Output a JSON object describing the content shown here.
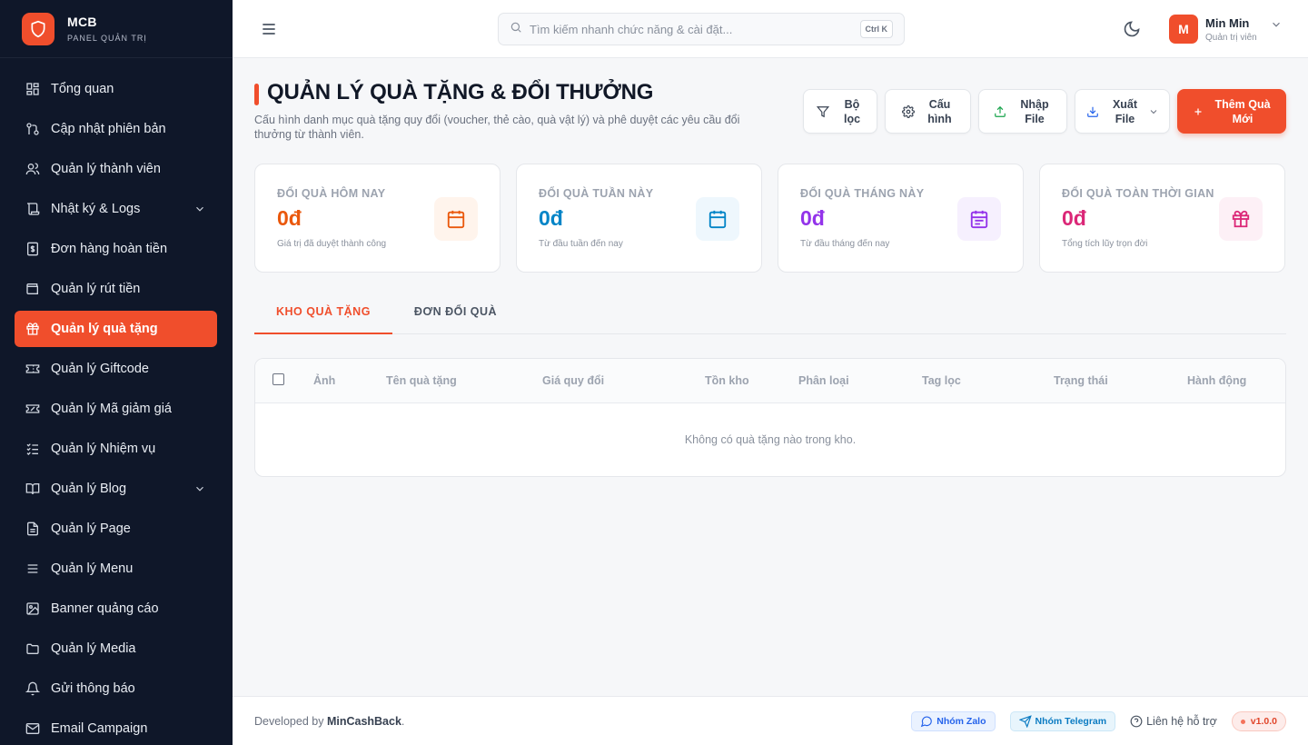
{
  "brand": {
    "name": "MCB",
    "subtitle": "PANEL QUẢN TRỊ"
  },
  "sidebar": {
    "items": [
      {
        "label": "Tổng quan",
        "icon": "dashboard-icon"
      },
      {
        "label": "Cập nhật phiên bản",
        "icon": "git-icon"
      },
      {
        "label": "Quản lý thành viên",
        "icon": "users-icon"
      },
      {
        "label": "Nhật ký & Logs",
        "icon": "scroll-icon",
        "expandable": true
      },
      {
        "label": "Đơn hàng hoàn tiền",
        "icon": "receipt-dollar-icon"
      },
      {
        "label": "Quản lý rút tiền",
        "icon": "wallet-icon"
      },
      {
        "label": "Quản lý quà tặng",
        "icon": "gift-icon",
        "active": true
      },
      {
        "label": "Quản lý Giftcode",
        "icon": "ticket-icon"
      },
      {
        "label": "Quản lý Mã giảm giá",
        "icon": "ticket-percent-icon"
      },
      {
        "label": "Quản lý Nhiệm vụ",
        "icon": "checklist-icon"
      },
      {
        "label": "Quản lý Blog",
        "icon": "book-icon",
        "expandable": true
      },
      {
        "label": "Quản lý Page",
        "icon": "file-icon"
      },
      {
        "label": "Quản lý Menu",
        "icon": "menu-icon"
      },
      {
        "label": "Banner quảng cáo",
        "icon": "image-icon"
      },
      {
        "label": "Quản lý Media",
        "icon": "folder-icon"
      },
      {
        "label": "Gửi thông báo",
        "icon": "bell-icon"
      },
      {
        "label": "Email Campaign",
        "icon": "mail-icon"
      }
    ]
  },
  "topbar": {
    "search_placeholder": "Tìm kiếm nhanh chức năng & cài đặt...",
    "shortcut": "Ctrl K",
    "user": {
      "initial": "M",
      "name": "Min Min",
      "role": "Quản trị viên"
    }
  },
  "page": {
    "title": "QUẢN LÝ QUÀ TẶNG & ĐỔI THƯỞNG",
    "description": "Cấu hình danh mục quà tặng quy đổi (voucher, thẻ cào, quà vật lý) và phê duyệt các yêu cầu đổi thưởng từ thành viên."
  },
  "actions": {
    "filter": "Bộ lọc",
    "config": "Cấu hình",
    "import": "Nhập File",
    "export": "Xuất File",
    "add": "Thêm Quà Mới"
  },
  "stats": [
    {
      "label": "ĐỔI QUÀ HÔM NAY",
      "value": "0đ",
      "sub": "Giá trị đã duyệt thành công",
      "color": "#ea580c",
      "bg": "#fff4ec",
      "icon": "calendar-icon"
    },
    {
      "label": "ĐỔI QUÀ TUẦN NÀY",
      "value": "0đ",
      "sub": "Từ đầu tuần đến nay",
      "color": "#0284c7",
      "bg": "#eef7fd",
      "icon": "calendar-days-icon"
    },
    {
      "label": "ĐỔI QUÀ THÁNG NÀY",
      "value": "0đ",
      "sub": "Từ đầu tháng đến nay",
      "color": "#9333ea",
      "bg": "#f6f0fe",
      "icon": "calendar-range-icon"
    },
    {
      "label": "ĐỔI QUÀ TOÀN THỜI GIAN",
      "value": "0đ",
      "sub": "Tổng tích lũy trọn đời",
      "color": "#db2777",
      "bg": "#fdf0f6",
      "icon": "gift-icon"
    }
  ],
  "tabs": [
    {
      "label": "KHO QUÀ TẶNG",
      "active": true
    },
    {
      "label": "ĐƠN ĐỔI QUÀ",
      "active": false
    }
  ],
  "table": {
    "columns": [
      "Ảnh",
      "Tên quà tặng",
      "Giá quy đổi",
      "Tồn kho",
      "Phân loại",
      "Tag lọc",
      "Trạng thái",
      "Hành động"
    ],
    "empty_message": "Không có quà tặng nào trong kho."
  },
  "footer": {
    "developed_prefix": "Developed by",
    "developer": "MinCashBack",
    "zalo": "Nhóm Zalo",
    "telegram": "Nhóm Telegram",
    "support": "Liên hệ hỗ trợ",
    "version": "v1.0.0"
  },
  "colors": {
    "accent": "#f04e2c",
    "sidebar_bg": "#0f1729"
  }
}
